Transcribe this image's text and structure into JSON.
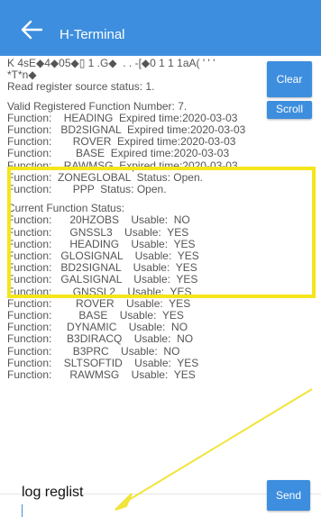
{
  "app": {
    "title": "H-Terminal",
    "back_icon": "arrow-left-icon"
  },
  "buttons": {
    "clear": "Clear",
    "scroll": "Scroll",
    "send": "Send"
  },
  "terminal": {
    "header_lines": [
      "K 4sE◆4◆05◆▯ 1 .G◆  . . -[◆0 1 1 1aA( ' ' ' ",
      "*T*n◆",
      "Read register source status: 1."
    ],
    "registered_lines": [
      "Valid Registered Function Number: 7.",
      "Function:    HEADING  Expired time:2020-03-03",
      "Function:   BD2SIGNAL  Expired time:2020-03-03",
      "Function:       ROVER  Expired time:2020-03-03",
      "Function:        BASE  Expired time:2020-03-03",
      "Function:    RAWMSG  Expired time:2020-03-03",
      "Function:  ZONEGLOBAL  Status: Open.",
      "Function:       PPP  Status: Open."
    ],
    "status_lines": [
      "Current Function Status:",
      "Function:      20HZOBS    Usable:  NO",
      "Function:      GNSSL3    Usable:  YES",
      "Function:      HEADING    Usable:  YES",
      "Function:   GLOSIGNAL    Usable:  YES",
      "Function:   BD2SIGNAL    Usable:  YES",
      "Function:   GALSIGNAL    Usable:  YES",
      "Function:       GNSSL2    Usable:  YES",
      "Function:        ROVER    Usable:  YES",
      "Function:         BASE    Usable:  YES",
      "Function:     DYNAMIC    Usable:  NO",
      "Function:     B3DIRACQ    Usable:  NO",
      "Function:       B3PRC    Usable:  NO",
      "Function:    SLTSOFTID    Usable:  YES",
      "Function:      RAWMSG    Usable:  YES"
    ]
  },
  "input": {
    "value": "log reglist"
  },
  "colors": {
    "accent": "#3d8ede",
    "highlight": "#f4e61a"
  }
}
